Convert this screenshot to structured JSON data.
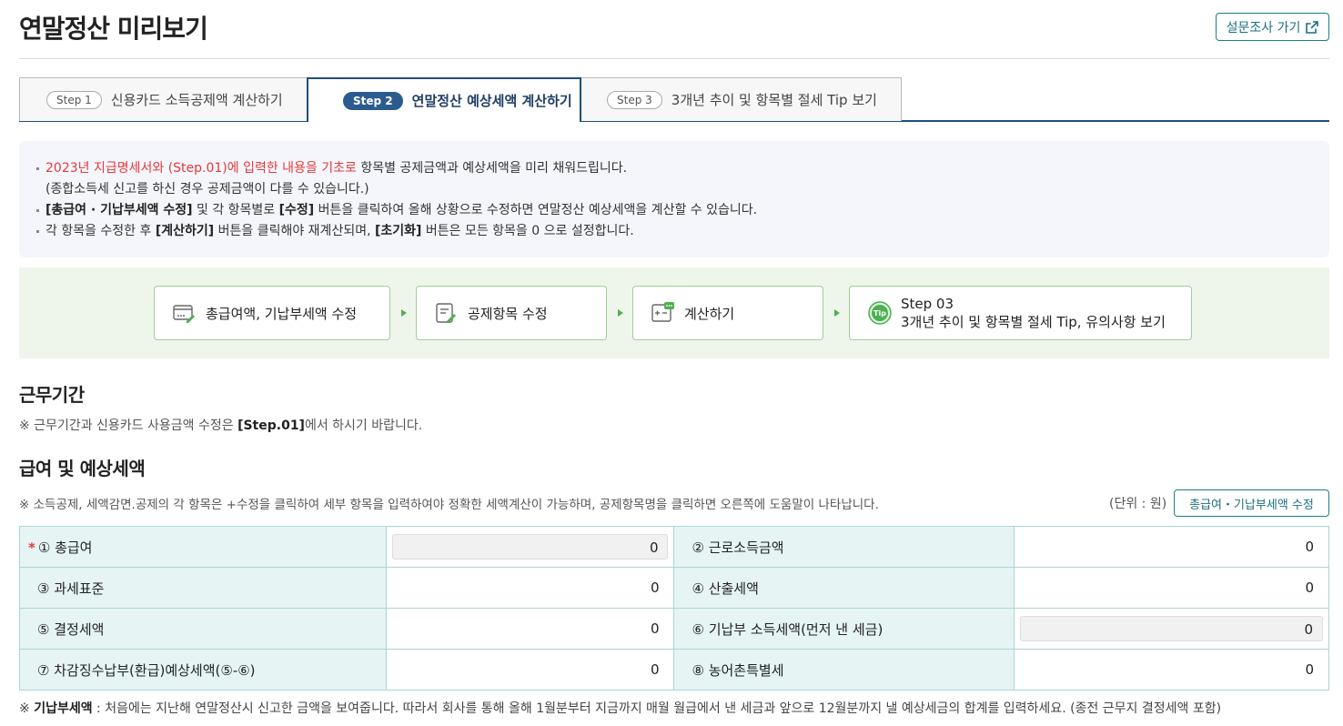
{
  "header": {
    "title": "연말정산 미리보기",
    "survey_label": "설문조사 가기"
  },
  "tabs": [
    {
      "step": "Step 1",
      "label": "신용카드 소득공제액 계산하기"
    },
    {
      "step": "Step 2",
      "label": "연말정산 예상세액 계산하기"
    },
    {
      "step": "Step 3",
      "label": "3개년 추이 및 항목별 절세 Tip 보기"
    }
  ],
  "notice": {
    "line1_red": "2023년 지급명세서와 (Step.01)에 입력한 내용을 기초로",
    "line1_rest": " 항목별 공제금액과 예상세액을 미리 채워드립니다.",
    "line1b": "(종합소득세 신고를 하신 경우 공제금액이 다를 수 있습니다.)",
    "line2_b1": "[총급여 · 기납부세액 수정]",
    "line2_t1": " 및 각 항목별로 ",
    "line2_b2": "[수정]",
    "line2_t2": " 버튼을 클릭하여 올해 상황으로 수정하면 연말정산 예상세액을 계산할 수 있습니다.",
    "line3_t1": "각 항목을 수정한 후 ",
    "line3_b1": "[계산하기]",
    "line3_t2": " 버튼을 클릭해야 재계산되며, ",
    "line3_b2": "[초기화]",
    "line3_t3": " 버튼은 모든 항목을 0 으로 설정합니다."
  },
  "flow": {
    "s1": "총급여액, 기납부세액 수정",
    "s2": "공제항목 수정",
    "s3": "계산하기",
    "s4_top": "Step 03",
    "s4_bottom": "3개년 추이 및 항목별 절세 Tip, 유의사항 보기"
  },
  "period": {
    "title": "근무기간",
    "note_t1": "※ 근무기간과 신용카드 사용금액 수정은 ",
    "note_b": "[Step.01]",
    "note_t2": "에서 하시기 바랍니다."
  },
  "salary": {
    "title": "급여 및 예상세액",
    "note": "※ 소득공제, 세액감면.공제의 각 항목은 +수정을 클릭하여 세부 항목을 입력하여야 정확한 세액계산이 가능하며, 공제항목명을 클릭하면 오른쪽에 도움말이 나타납니다.",
    "unit": "(단위 : 원)",
    "edit_button": "총급여・기납부세액 수정"
  },
  "table": {
    "required_mark": "*",
    "r1": {
      "l1": "① 총급여",
      "v1": "0",
      "l2": "② 근로소득금액",
      "v2": "0"
    },
    "r2": {
      "l1": "③ 과세표준",
      "v1": "0",
      "l2": "④ 산출세액",
      "v2": "0"
    },
    "r3": {
      "l1": "⑤ 결정세액",
      "v1": "0",
      "l2": "⑥ 기납부 소득세액(먼저 낸 세금)",
      "v2": "0"
    },
    "r4": {
      "l1": "⑦ 차감징수납부(환급)예상세액(⑤-⑥)",
      "v1": "0",
      "l2": "⑧ 농어촌특별세",
      "v2": "0"
    }
  },
  "footer": {
    "prefix": "※ ",
    "bold": "기납부세액",
    "text": " : 처음에는 지난해 연말정산시 신고한 금액을 보여줍니다. 따라서 회사를 통해 올해 1월분부터 지금까지 매월 월급에서 낸 세금과 앞으로 12월분까지 낼 예상세금의 합계를 입력하세요. (종전 근무지 결정세액 포함)"
  },
  "colors": {
    "accent_teal": "#1a7f86",
    "tab_navy": "#1f4f7a",
    "notice_red": "#e43a3a",
    "flow_green": "#4caf50"
  }
}
